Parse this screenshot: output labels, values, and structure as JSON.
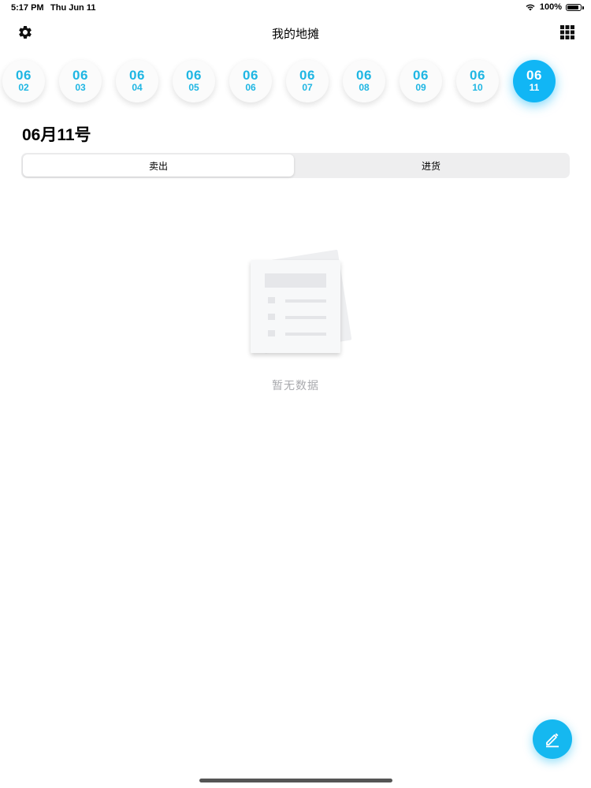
{
  "status_bar": {
    "time": "5:17 PM",
    "date": "Thu Jun 11",
    "battery_text": "100%",
    "battery_level": 1.0
  },
  "nav": {
    "title": "我的地摊",
    "left_icon": "gear-icon",
    "right_icon": "grid-icon"
  },
  "date_strip": {
    "items": [
      {
        "month": "06",
        "day": "02",
        "active": false
      },
      {
        "month": "06",
        "day": "03",
        "active": false
      },
      {
        "month": "06",
        "day": "04",
        "active": false
      },
      {
        "month": "06",
        "day": "05",
        "active": false
      },
      {
        "month": "06",
        "day": "06",
        "active": false
      },
      {
        "month": "06",
        "day": "07",
        "active": false
      },
      {
        "month": "06",
        "day": "08",
        "active": false
      },
      {
        "month": "06",
        "day": "09",
        "active": false
      },
      {
        "month": "06",
        "day": "10",
        "active": false
      },
      {
        "month": "06",
        "day": "11",
        "active": true
      }
    ],
    "accent_color": "#11b6f5",
    "text_color": "#1fb6e3"
  },
  "main": {
    "heading": "06月11号",
    "segments": [
      {
        "label": "卖出",
        "selected": true
      },
      {
        "label": "进货",
        "selected": false
      }
    ],
    "empty_state": {
      "caption": "暂无数据",
      "icon": "empty-document-icon"
    }
  },
  "fab": {
    "icon": "pencil-icon",
    "color": "#15b8f0"
  }
}
